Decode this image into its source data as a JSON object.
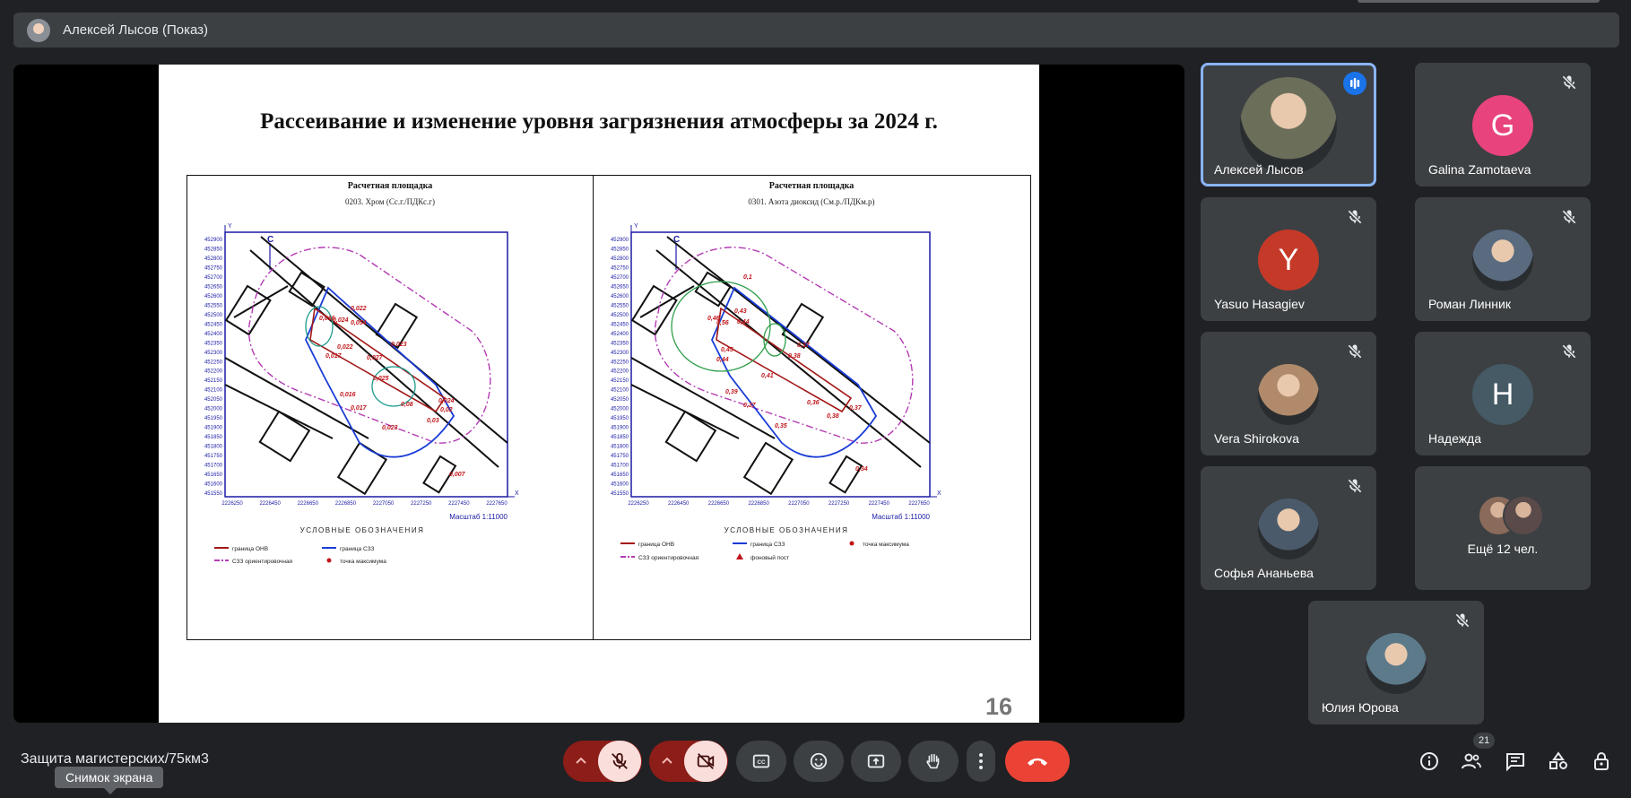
{
  "header": {
    "presenter": "Алексей Лысов (Показ)"
  },
  "slide": {
    "title": "Рассеивание и изменение уровня загрязнения атмосферы за 2024 г.",
    "page_number": "16",
    "left_map": {
      "heading": "Расчетная площадка",
      "substance": "0203. Хром (Сс.г./ПДКс.г)",
      "y_ticks": [
        "452900",
        "452850",
        "452800",
        "452750",
        "452700",
        "452650",
        "452600",
        "452550",
        "452500",
        "452450",
        "452400",
        "452350",
        "452300",
        "452250",
        "452200",
        "452150",
        "452100",
        "452050",
        "452000",
        "451950",
        "451900",
        "451850",
        "451800",
        "451750",
        "451700",
        "451650",
        "451600",
        "451550"
      ],
      "x_ticks": [
        "2226250",
        "2226450",
        "2226650",
        "2226850",
        "2227050",
        "2227250",
        "2227450",
        "2227650"
      ],
      "values": [
        "0,016",
        "0,024",
        "0,054",
        "0,022",
        "0,022",
        "0,017",
        "0,027",
        "0,023",
        "0,025",
        "0,016",
        "0,017",
        "0,023",
        "0,08",
        "0,024",
        "0,02",
        "0,03",
        "0,007"
      ],
      "scale": "Масштаб 1:11000",
      "legend_title": "УСЛОВНЫЕ ОБОЗНАЧЕНИЯ",
      "legend": [
        "граница ОНВ",
        "граница СЗЗ",
        "СЗЗ ориентировочная",
        "точка максимума"
      ]
    },
    "right_map": {
      "heading": "Расчетная площадка",
      "substance": "0301. Азота диоксид (Cм.р./ПДКм.р)",
      "y_ticks": [
        "452900",
        "452850",
        "452800",
        "452750",
        "452700",
        "452650",
        "452600",
        "452550",
        "452500",
        "452450",
        "452400",
        "452350",
        "452300",
        "452250",
        "452200",
        "452150",
        "452100",
        "452050",
        "452000",
        "451950",
        "451900",
        "451850",
        "451800",
        "451750",
        "451700",
        "451650",
        "451600",
        "451550"
      ],
      "x_ticks": [
        "2226250",
        "2226450",
        "2226650",
        "2226850",
        "2227050",
        "2227250",
        "2227450",
        "2227650"
      ],
      "values": [
        "0,1",
        "0,46",
        "0,56",
        "0,43",
        "0,44",
        "0,45",
        "0,44",
        "0,37",
        "0,38",
        "0,41",
        "0,39",
        "0,37",
        "0,36",
        "0,38",
        "0,37",
        "0,35",
        "0,34"
      ],
      "scale": "Масштаб 1:11000",
      "legend_title": "УСЛОВНЫЕ ОБОЗНАЧЕНИЯ",
      "legend": [
        "граница ОНВ",
        "граница СЗЗ",
        "точка максимума",
        "СЗЗ ориентировочная",
        "фоновый пост"
      ]
    }
  },
  "participants": [
    {
      "name": "Алексей Лысов",
      "type": "photo",
      "active": true,
      "speaking": true
    },
    {
      "name": "Galina Zamotaeva",
      "type": "letter",
      "letter": "G",
      "color": "#e8437c"
    },
    {
      "name": "Yasuo Hasagiev",
      "type": "letter",
      "letter": "Y",
      "color": "#c53929"
    },
    {
      "name": "Роман Линник",
      "type": "photo"
    },
    {
      "name": "Vera Shirokova",
      "type": "photo"
    },
    {
      "name": "Надежда",
      "type": "letter",
      "letter": "H",
      "color": "#455a64"
    },
    {
      "name": "Софья Ананьева",
      "type": "photo"
    },
    {
      "name": "Ещё 12 чел.",
      "type": "more"
    },
    {
      "name": "Юлия Юрова",
      "type": "photo"
    }
  ],
  "meeting": {
    "name": "Защита магистерских/75км3",
    "tooltip": "Снимок экрана",
    "people_count": "21"
  },
  "colors": {
    "bg": "#202124",
    "tile": "#3c4043",
    "accent": "#8ab4f8",
    "danger": "#ea4335",
    "mic_off_bg": "#f9dedc"
  }
}
